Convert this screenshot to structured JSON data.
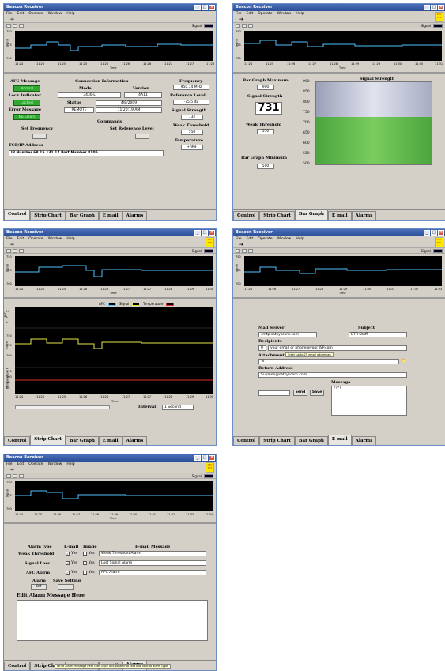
{
  "window": {
    "title": "Beacon Receiver",
    "menu": [
      "File",
      "Edit",
      "Operate",
      "Window",
      "Help"
    ],
    "signal_label": "Signal",
    "badge": "CTC SYS"
  },
  "strip": {
    "ylabel": "Signal",
    "xlabel": "Time",
    "yticks": [
      "750",
      "725",
      "700"
    ],
    "xticks_a": [
      "11:24",
      "11:25",
      "11:25",
      "11:25",
      "11:26",
      "11:26",
      "11:26",
      "11:27",
      "11:27",
      "11:28"
    ],
    "xticks_b": [
      "11:24",
      "11:25",
      "11:26",
      "11:27",
      "11:28",
      "11:29",
      "11:29",
      "11:30",
      "11:30",
      "11:31"
    ],
    "xticks_c": [
      "11:24",
      "11:25",
      "11:25",
      "11:26",
      "11:26",
      "11:27",
      "11:27",
      "11:28",
      "11:29",
      "11:30"
    ],
    "xticks_d": [
      "11:24",
      "11:26",
      "11:27",
      "11:28",
      "11:29",
      "11:30",
      "11:31",
      "11:32",
      "11:33"
    ],
    "xticks_e": [
      "11:24",
      "11:25",
      "11:26",
      "11:27",
      "11:28",
      "11:29",
      "11:30",
      "11:31",
      "11:32",
      "11:33",
      "11:34"
    ]
  },
  "tabs": [
    "Control",
    "Strip Chart",
    "Bar Graph",
    "E mail",
    "Alarms"
  ],
  "control": {
    "afc_title": "AFC Message",
    "afc_value": "Normal",
    "lock_title": "Lock Indicator",
    "lock_value": "Locked",
    "err_title": "Error Message",
    "err_value": "No Errors",
    "conn_title": "Connection Information",
    "model_h": "Model",
    "version_h": "Version",
    "model": "3430-L",
    "version": "4A11",
    "status_h": "Status",
    "date": "4/8/2009",
    "status": "REMOTE",
    "time": "11:20:19 AM",
    "freq_t": "Frequency",
    "freq": "950.14 MHz",
    "ref_t": "Reference Level",
    "ref": "-75.5 dB",
    "ss_t": "Signal Strength",
    "ss": "732",
    "wt_t": "Weak Threshold",
    "wt": "550",
    "temp_t": "Temperature",
    "temp": "+ 96F",
    "cmd_t": "Commands",
    "setfreq": "Set Frequency",
    "setref": "Set Reference Level",
    "tcp_t": "TCP/IP Address",
    "tcp": "IP Number 68.15.131.17 Port Number 8105"
  },
  "bar": {
    "max_t": "Bar Graph Maximum",
    "max": "900",
    "ss_t": "Signal Strength",
    "ss": "731",
    "wt_t": "Weak Threshold",
    "wt": "550",
    "min_t": "Bar Graph Minimum",
    "min": "500",
    "chart_t": "Signal Strength",
    "ticks": [
      "900",
      "850",
      "800",
      "750",
      "700",
      "650",
      "600",
      "550",
      "500"
    ]
  },
  "strip2": {
    "legend_afc": "AFC",
    "legend_sig": "Signal",
    "legend_temp": "Temperature",
    "afc_label": "AFC",
    "sig_label": "Signal",
    "temp_label": "Temperature F",
    "afc_ticks": [
      "H",
      "L",
      "L"
    ],
    "sig_ticks": [
      "750",
      "725",
      "700"
    ],
    "temp_ticks": [
      "110",
      "100",
      "90",
      "80"
    ],
    "interval_t": "Interval",
    "interval": "1 Second",
    "time_label": "Time"
  },
  "email": {
    "server_t": "Mail Server",
    "server": "smtp.satsyscorp.com",
    "subj_t": "Subject",
    "subj": "BTR Stuff",
    "rec_t": "Recipients",
    "rec_idx": "0",
    "rec": "your email or phone@your ISP.com",
    "tip": "Enter up to 25 email addresses",
    "att_t": "Attachment",
    "att": "%",
    "ret_t": "Return Address",
    "ret": "Suymon@satsyscorp.com",
    "msg_t": "Message",
    "msg": "????",
    "send": "Send",
    "save": "Save"
  },
  "alarms": {
    "type_h": "Alarm type",
    "email_h": "E-mail",
    "image_h": "Image",
    "msg_h": "E-mail Message",
    "rows": [
      {
        "name": "Weak Threshold",
        "yes1": "Yes",
        "yes2": "Yes",
        "msg": "Weak Threshold Alarm"
      },
      {
        "name": "Signal Loss",
        "yes1": "Yes",
        "yes2": "Yes",
        "msg": "Lost Signal Alarm"
      },
      {
        "name": "AFC Alarm",
        "yes1": "Yes",
        "yes2": "Yes",
        "msg": "AFC Alarm"
      }
    ],
    "alarm_t": "Alarm",
    "alarm_v": "Off",
    "save_t": "Save Setting",
    "edit_t": "Edit Alarm Message Here",
    "tip": "Write alarm message here then copy and paste into text box next to alarm type."
  },
  "colors": {
    "trace": "#4fc3ff",
    "signal": "#e6e64a",
    "temp": "#e03030",
    "led": "#2ea82e",
    "barTop": "#c8cbdb",
    "barBottom": "#55b34a"
  }
}
